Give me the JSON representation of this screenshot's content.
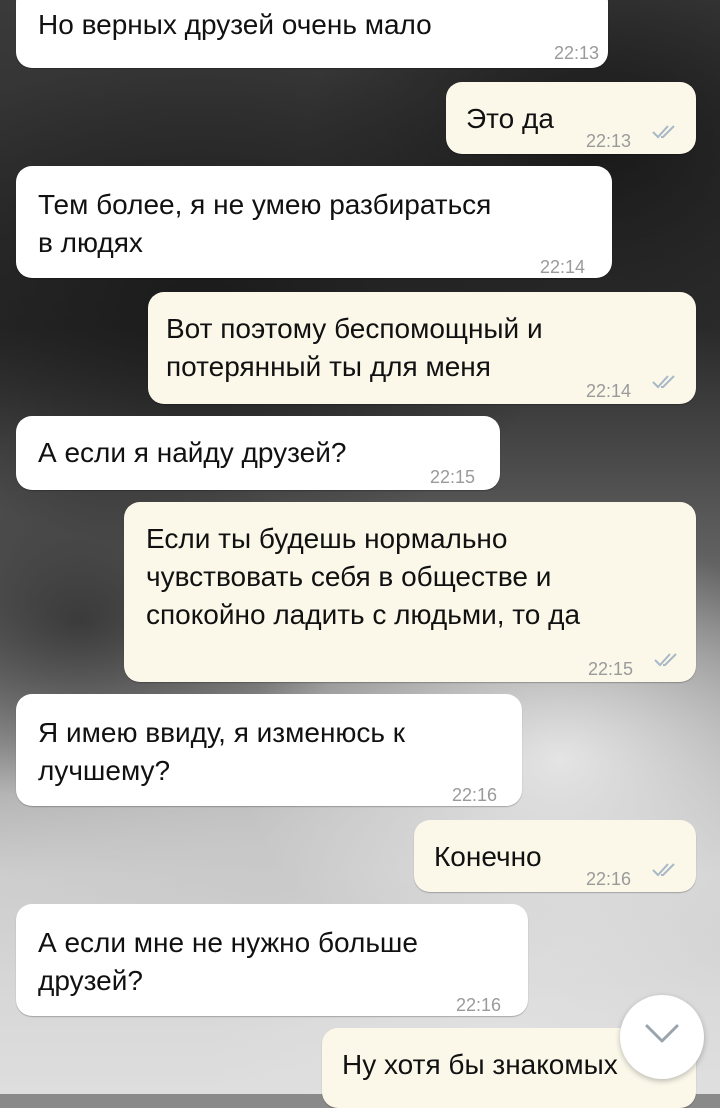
{
  "messages": [
    {
      "text": "Но верных друзей очень мало",
      "time": "22:13"
    },
    {
      "text": "Это да",
      "time": "22:13"
    },
    {
      "text": "Тем более, я не умею разбираться\nв людях",
      "time": "22:14"
    },
    {
      "text": "Вот поэтому беспомощный и\nпотерянный ты для меня",
      "time": "22:14"
    },
    {
      "text": "А если я найду друзей?",
      "time": "22:15"
    },
    {
      "text": "Если ты будешь нормально\nчувствовать себя в обществе и\nспокойно ладить с людьми, то да",
      "time": "22:15"
    },
    {
      "text": "Я имею ввиду, я изменюсь к\nлучшему?",
      "time": "22:16"
    },
    {
      "text": "Конечно",
      "time": "22:16"
    },
    {
      "text": "А если мне не нужно больше\nдрузей?",
      "time": "22:16"
    },
    {
      "text": "Ну хотя бы знакомых",
      "time": ""
    }
  ],
  "icons": {
    "read_receipt": "double-check-icon",
    "scroll_down": "chevron-down-icon"
  },
  "colors": {
    "incoming_bubble": "#ffffff",
    "outgoing_bubble": "#fbf8ea",
    "read_check": "#a9b8c6",
    "timestamp": "#9a9a9a"
  }
}
